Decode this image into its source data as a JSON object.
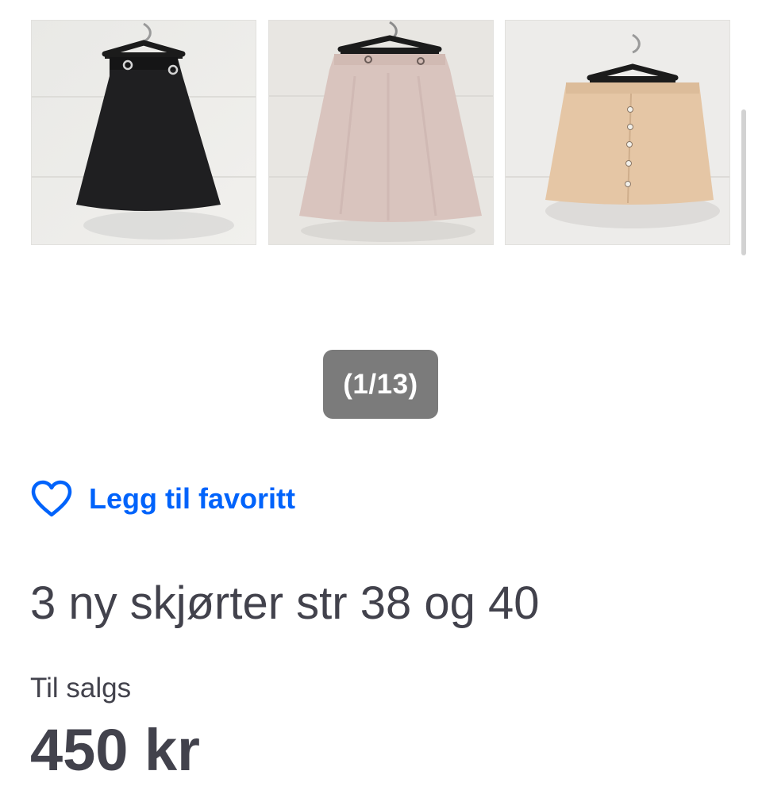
{
  "gallery": {
    "images": [
      {
        "alt": "Black skirt on hanger"
      },
      {
        "alt": "Pink skirt on hanger"
      },
      {
        "alt": "Beige button skirt on hanger"
      }
    ],
    "counter": "(1/13)"
  },
  "favorite": {
    "label": "Legg til favoritt",
    "icon": "heart-outline-icon"
  },
  "listing": {
    "title": "3 ny skjørter str 38 og 40",
    "status": "Til salgs",
    "price": "450 kr"
  },
  "colors": {
    "accent": "#0063fb",
    "text": "#42424c",
    "counter_bg": "#7b7b7b"
  }
}
